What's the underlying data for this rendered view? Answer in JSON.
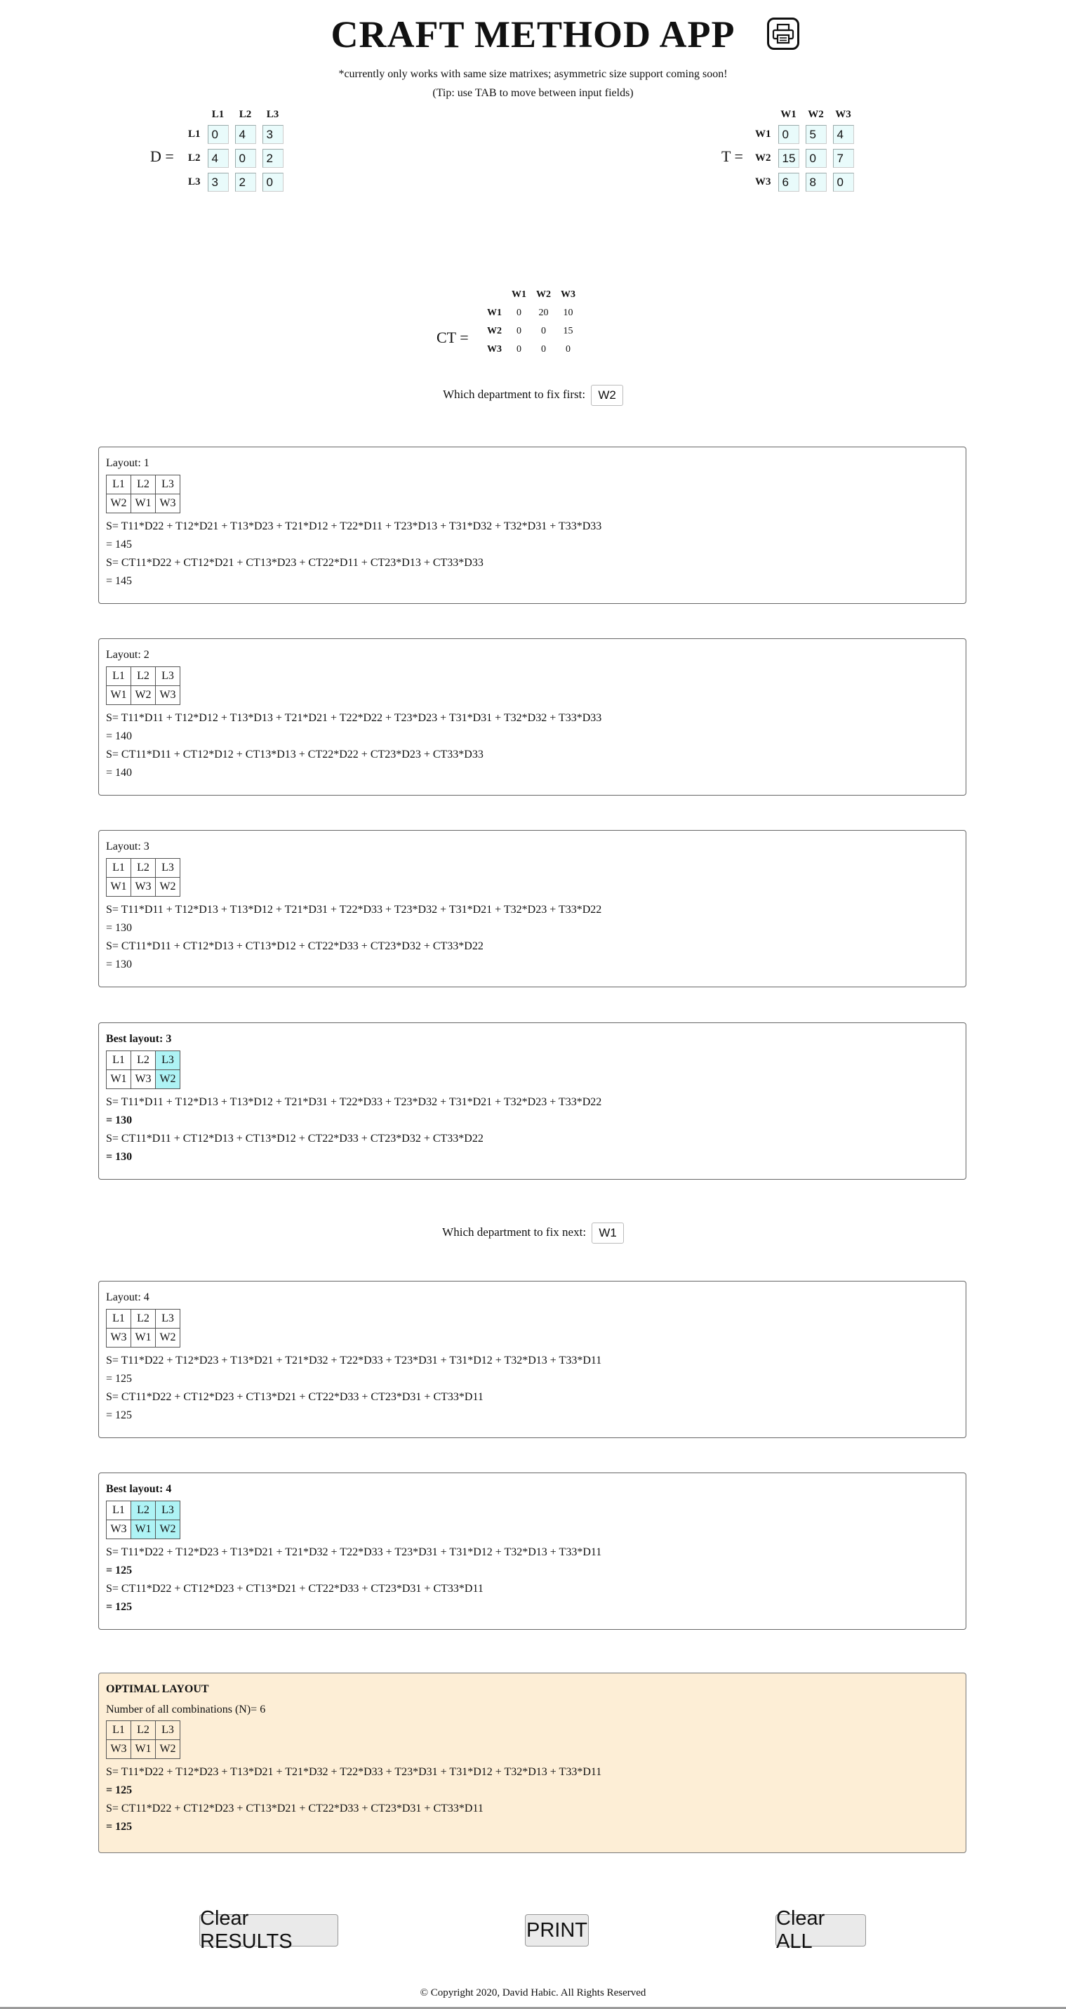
{
  "app": {
    "title": "CRAFT METHOD APP",
    "note": "*currently only works with same size matrixes; asymmetric size support coming soon!",
    "tip": "(Tip: use TAB to move between input fields)"
  },
  "d_matrix": {
    "label": "D =",
    "cols": [
      "L1",
      "L2",
      "L3"
    ],
    "rows": [
      {
        "name": "L1",
        "values": [
          "0",
          "4",
          "3"
        ]
      },
      {
        "name": "L2",
        "values": [
          "4",
          "0",
          "2"
        ]
      },
      {
        "name": "L3",
        "values": [
          "3",
          "2",
          "0"
        ]
      }
    ]
  },
  "t_matrix": {
    "label": "T =",
    "cols": [
      "W1",
      "W2",
      "W3"
    ],
    "rows": [
      {
        "name": "W1",
        "values": [
          "0",
          "5",
          "4"
        ]
      },
      {
        "name": "W2",
        "values": [
          "15",
          "0",
          "7"
        ]
      },
      {
        "name": "W3",
        "values": [
          "6",
          "8",
          "0"
        ]
      }
    ]
  },
  "ct_matrix": {
    "label": "CT =",
    "cols": [
      "W1",
      "W2",
      "W3"
    ],
    "rows": [
      {
        "name": "W1",
        "values": [
          "0",
          "20",
          "10"
        ]
      },
      {
        "name": "W2",
        "values": [
          "0",
          "0",
          "15"
        ]
      },
      {
        "name": "W3",
        "values": [
          "0",
          "0",
          "0"
        ]
      }
    ]
  },
  "fix_first": {
    "label": "Which department to fix first:",
    "value": "W2"
  },
  "fix_next": {
    "label": "Which department to fix next:",
    "value": "W1"
  },
  "layouts": [
    {
      "title": "Layout: 1",
      "bold": false,
      "locations": [
        "L1",
        "L2",
        "L3"
      ],
      "departments": [
        "W2",
        "W1",
        "W3"
      ],
      "s1": "S= T11*D22 + T12*D21 + T13*D23 + T21*D12 + T22*D11 + T23*D13 + T31*D32 + T32*D31 + T33*D33",
      "r1": "= 145",
      "s2": "S= CT11*D22 + CT12*D21 + CT13*D23 + CT22*D11 + CT23*D13 + CT33*D33",
      "r2": "= 145"
    },
    {
      "title": "Layout: 2",
      "bold": false,
      "locations": [
        "L1",
        "L2",
        "L3"
      ],
      "departments": [
        "W1",
        "W2",
        "W3"
      ],
      "s1": "S= T11*D11 + T12*D12 + T13*D13 + T21*D21 + T22*D22 + T23*D23 + T31*D31 + T32*D32 + T33*D33",
      "r1": "= 140",
      "s2": "S= CT11*D11 + CT12*D12 + CT13*D13 + CT22*D22 + CT23*D23 + CT33*D33",
      "r2": "= 140"
    },
    {
      "title": "Layout: 3",
      "bold": false,
      "locations": [
        "L1",
        "L2",
        "L3"
      ],
      "departments": [
        "W1",
        "W3",
        "W2"
      ],
      "s1": "S= T11*D11 + T12*D13 + T13*D12 + T21*D31 + T22*D33 + T23*D32 + T31*D21 + T32*D23 + T33*D22",
      "r1": "= 130",
      "s2": "S= CT11*D11 + CT12*D13 + CT13*D12 + CT22*D33 + CT23*D32 + CT33*D22",
      "r2": "= 130"
    },
    {
      "title": "Best layout: 3",
      "bold": true,
      "locations": [
        "L1",
        "L2",
        "L3"
      ],
      "departments": [
        "W1",
        "W3",
        "W2"
      ],
      "s1": "S= T11*D11 + T12*D13 + T13*D12 + T21*D31 + T22*D33 + T23*D32 + T31*D21 + T32*D23 + T33*D22",
      "r1": "= 130",
      "s2": "S= CT11*D11 + CT12*D13 + CT13*D12 + CT22*D33 + CT23*D32 + CT33*D22",
      "r2": "= 130"
    },
    {
      "title": "Layout: 4",
      "bold": false,
      "locations": [
        "L1",
        "L2",
        "L3"
      ],
      "departments": [
        "W3",
        "W1",
        "W2"
      ],
      "s1": "S= T11*D22 + T12*D23 + T13*D21 + T21*D32 + T22*D33 + T23*D31 + T31*D12 + T32*D13 + T33*D11",
      "r1": "= 125",
      "s2": "S= CT11*D22 + CT12*D23 + CT13*D21 + CT22*D33 + CT23*D31 + CT33*D11",
      "r2": "= 125"
    },
    {
      "title": "Best layout: 4",
      "bold": true,
      "locations": [
        "L1",
        "L2",
        "L3"
      ],
      "departments": [
        "W3",
        "W1",
        "W2"
      ],
      "s1": "S= T11*D22 + T12*D23 + T13*D21 + T21*D32 + T22*D33 + T23*D31 + T31*D12 + T32*D13 + T33*D11",
      "r1": "= 125",
      "s2": "S= CT11*D22 + CT12*D23 + CT13*D21 + CT22*D33 + CT23*D31 + CT33*D11",
      "r2": "= 125"
    }
  ],
  "optimal": {
    "title": "OPTIMAL LAYOUT",
    "combinations": "Number of all combinations (N)= 6",
    "locations": [
      "L1",
      "L2",
      "L3"
    ],
    "departments": [
      "W3",
      "W1",
      "W2"
    ],
    "s1": "S= T11*D22 + T12*D23 + T13*D21 + T21*D32 + T22*D33 + T23*D31 + T31*D12 + T32*D13 + T33*D11",
    "r1": "= 125",
    "s2": "S= CT11*D22 + CT12*D23 + CT13*D21 + CT22*D33 + CT23*D31 + CT33*D11",
    "r2": "= 125"
  },
  "buttons": {
    "clear_results": "Clear RESULTS",
    "print": "PRINT",
    "clear_all": "Clear ALL"
  },
  "footer": "© Copyright 2020, David Habic. All Rights Reserved",
  "colors": {
    "input_bg": "#e9fbfb",
    "highlight": "#aef3f5",
    "optimal_bg": "#fdeed6",
    "button_bg": "#eaeaea"
  },
  "icons": {
    "print": "printer-icon"
  }
}
